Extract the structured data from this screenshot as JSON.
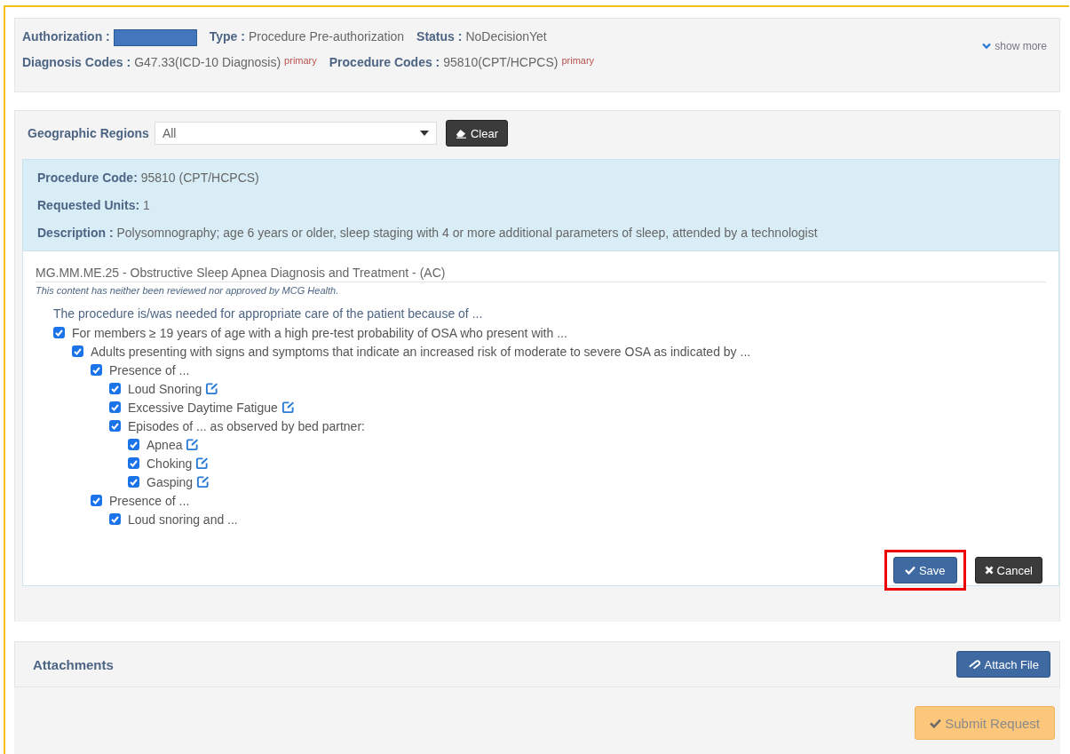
{
  "summary": {
    "fields": [
      {
        "label": "Authorization :",
        "redacted": true
      },
      {
        "label": "Type :",
        "value": "Procedure Pre-authorization"
      },
      {
        "label": "Status :",
        "value": "NoDecisionYet"
      }
    ],
    "codes": [
      {
        "label": "Diagnosis Codes :",
        "value": "G47.33(ICD-10 Diagnosis)",
        "tag": "primary"
      },
      {
        "label": "Procedure Codes :",
        "value": "95810(CPT/HCPCS)",
        "tag": "primary"
      }
    ],
    "show_more": "show more"
  },
  "filter": {
    "label": "Geographic Regions",
    "value": "All",
    "clear_button": "Clear"
  },
  "procedure": [
    {
      "label": "Procedure Code:",
      "value": "95810 (CPT/HCPCS)"
    },
    {
      "label": "Requested Units:",
      "value": "1"
    },
    {
      "label": "Description :",
      "value": "Polysomnography; age 6 years or older, sleep staging with 4 or more additional parameters of sleep, attended by a technologist"
    }
  ],
  "guideline": {
    "title": "MG.MM.ME.25 - Obstructive Sleep Apnea Diagnosis and Treatment - (AC)",
    "disclaimer": "This content has neither been reviewed nor approved by MCG Health.",
    "intro": "The procedure is/was needed for appropriate care of the patient because of ...",
    "criteria": [
      {
        "text": "For members ≥ 19 years of age with a high pre-test probability of OSA who present with ...",
        "checked": true,
        "note": false,
        "children": [
          {
            "text": "Adults presenting with signs and symptoms that indicate an increased risk of moderate to severe OSA as indicated by ...",
            "checked": true,
            "note": false,
            "children": [
              {
                "text": "Presence of ...",
                "checked": true,
                "note": false,
                "children": [
                  {
                    "text": "Loud Snoring",
                    "checked": true,
                    "note": true
                  },
                  {
                    "text": "Excessive Daytime Fatigue",
                    "checked": true,
                    "note": true
                  },
                  {
                    "text": "Episodes of ... as observed by bed partner:",
                    "checked": true,
                    "note": false,
                    "children": [
                      {
                        "text": "Apnea",
                        "checked": true,
                        "note": true
                      },
                      {
                        "text": "Choking",
                        "checked": true,
                        "note": true
                      },
                      {
                        "text": "Gasping",
                        "checked": true,
                        "note": true
                      }
                    ]
                  }
                ]
              },
              {
                "text": "Presence of ...",
                "checked": true,
                "note": false,
                "children": [
                  {
                    "text": "Loud snoring and ...",
                    "checked": true,
                    "note": false
                  }
                ]
              }
            ]
          }
        ]
      }
    ]
  },
  "actions": {
    "save": "Save",
    "cancel": "Cancel",
    "save_highlighted": true
  },
  "attachments": {
    "title": "Attachments",
    "button": "Attach File"
  },
  "submit": {
    "label": "Submit Request",
    "disabled": true
  }
}
